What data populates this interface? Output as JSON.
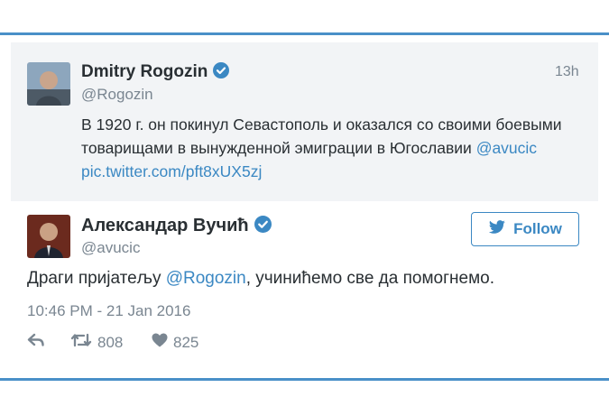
{
  "tweet1": {
    "name": "Dmitry Rogozin",
    "handle": "@Rogozin",
    "time": "13h",
    "text_line1": "В 1920 г. он покинул Севастополь и оказался со своими боевыми",
    "text_line2_plain": "товарищами в вынужденной эмиграции в Югославии ",
    "text_line2_mention": "@avucic",
    "text_link": "pic.twitter.com/pft8xUX5zj"
  },
  "tweet2": {
    "name": "Александар Вучић",
    "handle": "@avucic",
    "follow_label": "Follow",
    "text_before": "Драги пријатељу ",
    "text_mention": "@Rogozin",
    "text_after": ", учинићемо све да помогнемо.",
    "datetime": "10:46 PM - 21 Jan 2016",
    "retweets": "808",
    "likes": "825"
  },
  "colors": {
    "accent": "#3b88c3",
    "frame_border": "#4a90c8",
    "muted": "#7a8691",
    "text": "#292f33",
    "quoted_bg": "#f2f4f6"
  }
}
